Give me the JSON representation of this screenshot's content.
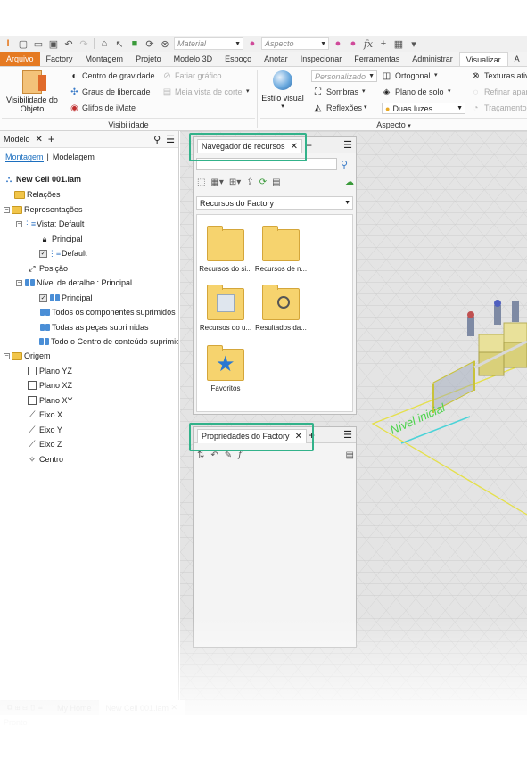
{
  "qat": {
    "material_placeholder": "Material",
    "appearance_placeholder": "Aspecto"
  },
  "tabs": [
    {
      "label": "Arquivo",
      "kind": "file"
    },
    {
      "label": "Factory"
    },
    {
      "label": "Montagem"
    },
    {
      "label": "Projeto"
    },
    {
      "label": "Modelo 3D"
    },
    {
      "label": "Esboço"
    },
    {
      "label": "Anotar"
    },
    {
      "label": "Inspecionar"
    },
    {
      "label": "Ferramentas"
    },
    {
      "label": "Administrar"
    },
    {
      "label": "Visualizar",
      "active": true
    },
    {
      "label": "A"
    }
  ],
  "ribbon": {
    "visibility_object_line1": "Visibilidade do",
    "visibility_object_line2": "Objeto",
    "center_gravity": "Centro de gravidade",
    "degrees_freedom": "Graus de liberdade",
    "imate_glyphs": "Glifos de iMate",
    "slice_graphics": "Fatiar gráfico",
    "half_section": "Meia vista de corte",
    "group_visibility": "Visibilidade",
    "visual_style": "Estilo visual",
    "custom_dd": "Personalizado",
    "shadows": "Sombras",
    "reflections": "Reflexões",
    "orthographic": "Ortogonal",
    "ground_plane": "Plano de solo",
    "two_lights": "Duas luzes",
    "textures": "Texturas ativ",
    "refine": "Refinar apar",
    "raytracing": "Traçamento",
    "group_appearance": "Aspecto"
  },
  "model_browser": {
    "title": "Modelo",
    "subtab_assembly": "Montagem",
    "subtab_modeling": "Modelagem",
    "tree": [
      {
        "label": "New Cell 001.iam",
        "bold": true,
        "icon": "assembly-icon"
      },
      {
        "label": "Relações",
        "icon": "folder-icon"
      },
      {
        "label": "Representações",
        "icon": "representations-icon"
      },
      {
        "label": "Vista: Default",
        "icon": "view-rep-icon"
      },
      {
        "label": "Principal",
        "icon": "lock-icon"
      },
      {
        "label": "Default",
        "icon": "view-rep-icon"
      },
      {
        "label": "Posição",
        "icon": "position-icon"
      },
      {
        "label": "Nível de detalhe : Principal",
        "icon": "lod-icon"
      },
      {
        "label": "Principal",
        "icon": "lod-icon"
      },
      {
        "label": "Todos os componentes suprimidos",
        "icon": "lod-icon"
      },
      {
        "label": "Todas as peças suprimidas",
        "icon": "lod-icon"
      },
      {
        "label": "Todo o Centro de conteúdo suprimido",
        "icon": "lod-icon"
      },
      {
        "label": "Origem",
        "icon": "folder-icon"
      },
      {
        "label": "Plano YZ",
        "icon": "plane-icon"
      },
      {
        "label": "Plano XZ",
        "icon": "plane-icon"
      },
      {
        "label": "Plano XY",
        "icon": "plane-icon"
      },
      {
        "label": "Eixo X",
        "icon": "axis-icon"
      },
      {
        "label": "Eixo Y",
        "icon": "axis-icon"
      },
      {
        "label": "Eixo Z",
        "icon": "axis-icon"
      },
      {
        "label": "Centro",
        "icon": "point-icon"
      }
    ]
  },
  "asset_browser": {
    "tab_label": "Navegador de recursos",
    "source_dropdown": "Recursos do Factory",
    "items": [
      {
        "label": "Recursos do si..."
      },
      {
        "label": "Recursos de n..."
      },
      {
        "label": "Recursos do u..."
      },
      {
        "label": "Resultados da..."
      },
      {
        "label": "Favoritos"
      }
    ]
  },
  "properties": {
    "tab_label": "Propriedades do Factory"
  },
  "viewport": {
    "floor_label": "Nível inicial"
  },
  "doc_tabs": {
    "home": "My Home",
    "file": "New Cell 001.iam"
  },
  "status": {
    "text": "Pronto"
  },
  "colors": {
    "file_tab": "#e57a22",
    "highlight": "#32b28a",
    "accent_blue": "#1c6fbf"
  }
}
